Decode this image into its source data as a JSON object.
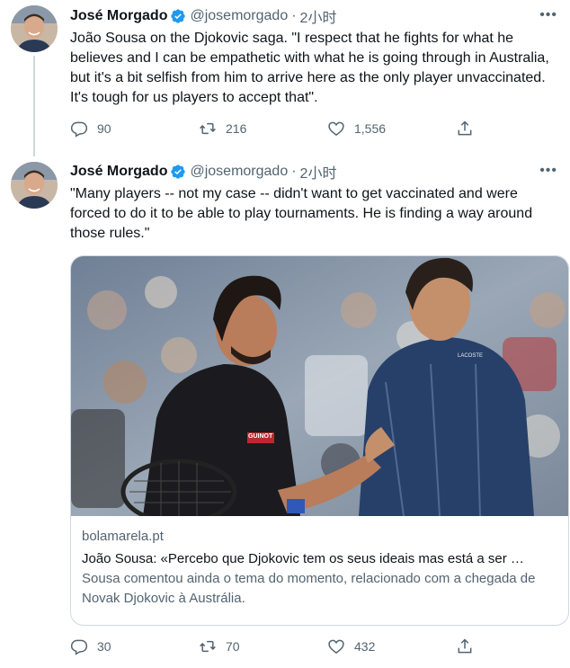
{
  "tweets": [
    {
      "author_name": "José Morgado",
      "handle": "@josemorgado",
      "separator": "·",
      "time": "2小时",
      "more": "•••",
      "text": "João Sousa on the Djokovic saga. \"I respect that he fights for what he believes and I can be empathetic with what he is going through in Australia, but it's a bit selfish from him to arrive here as the only player unvaccinated. It's tough for us players to accept that\".",
      "replies": "90",
      "retweets": "216",
      "likes": "1,556"
    },
    {
      "author_name": "José Morgado",
      "handle": "@josemorgado",
      "separator": "·",
      "time": "2小时",
      "more": "•••",
      "text": "\"Many players -- not my case -- didn't want to get vaccinated and were forced to do it to be able to play tournaments. He is finding a way around those rules.\"",
      "card": {
        "domain": "bolamarela.pt",
        "title": "João Sousa: «Percebo que Djokovic tem os seus ideais mas está a ser …",
        "description": "Sousa comentou ainda o tema do momento, relacionado com a chegada de Novak Djokovic à Austrália.",
        "shirt_logo_left": "GUINOT",
        "shirt_logo_right": "LACOSTE"
      },
      "replies": "30",
      "retweets": "70",
      "likes": "432"
    }
  ],
  "icons": {
    "verified": "verified-badge-icon",
    "reply": "reply-icon",
    "retweet": "retweet-icon",
    "like": "heart-icon",
    "share": "share-icon",
    "more": "more-icon"
  },
  "colors": {
    "verified": "#1d9bf0",
    "secondary_text": "#536471",
    "border": "#cfd9de"
  }
}
